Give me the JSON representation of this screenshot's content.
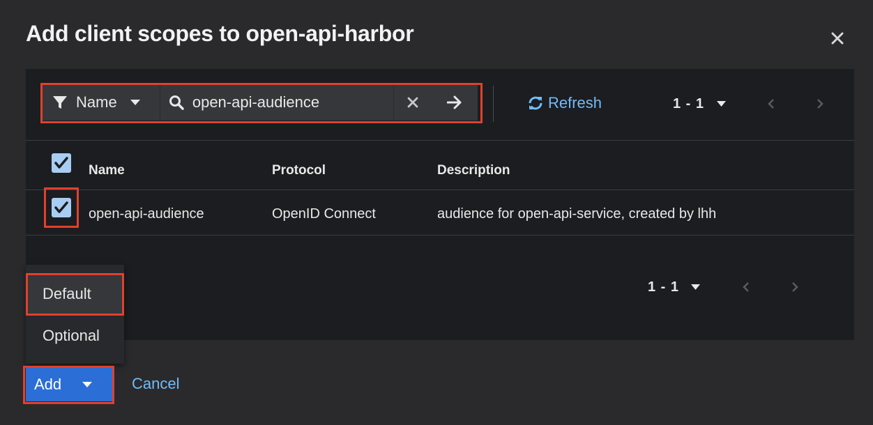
{
  "modal": {
    "title": "Add client scopes to open-api-harbor",
    "close_icon": "close-icon"
  },
  "toolbar": {
    "filter_attribute": "Name",
    "search_value": "open-api-audience",
    "refresh_label": "Refresh",
    "pagination": "1 - 1"
  },
  "table": {
    "columns": [
      "Name",
      "Protocol",
      "Description"
    ],
    "rows": [
      {
        "selected": true,
        "name": "open-api-audience",
        "protocol": "OpenID Connect",
        "description": "audience for open-api-service, created by lhh"
      }
    ],
    "select_all_checked": true,
    "bottom_pagination": "1 - 1"
  },
  "add_menu": {
    "items": [
      "Default",
      "Optional"
    ],
    "active_item": "Default"
  },
  "footer": {
    "add_label": "Add",
    "cancel_label": "Cancel"
  },
  "colors": {
    "background": "#2a2a2d",
    "panel": "#1b1d21",
    "accent_link": "#73bcf7",
    "primary_button": "#2b6ed6",
    "highlight_box": "#e0412c",
    "checkbox": "#a8cdf2"
  }
}
